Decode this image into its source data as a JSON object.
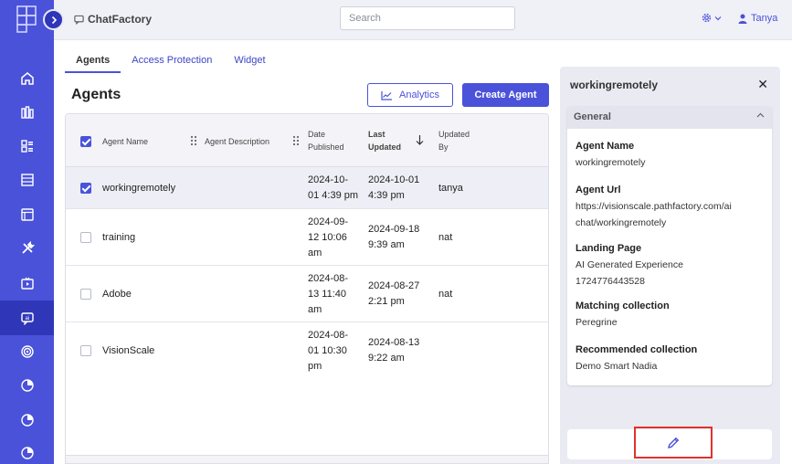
{
  "app": {
    "title": "ChatFactory",
    "search_placeholder": "Search",
    "user_name": "Tanya",
    "accent": "#4a52d9"
  },
  "sidebar": {
    "items": [
      {
        "icon": "home-icon"
      },
      {
        "icon": "library-icon"
      },
      {
        "icon": "grid-icon"
      },
      {
        "icon": "table-icon"
      },
      {
        "icon": "window-icon"
      },
      {
        "icon": "tools-icon"
      },
      {
        "icon": "video-icon"
      },
      {
        "icon": "chat-icon",
        "active": true
      },
      {
        "icon": "target-icon"
      },
      {
        "icon": "pie-icon"
      },
      {
        "icon": "pie-icon"
      },
      {
        "icon": "pie-icon"
      }
    ]
  },
  "tabs": [
    {
      "label": "Agents",
      "active": true
    },
    {
      "label": "Access Protection"
    },
    {
      "label": "Widget"
    }
  ],
  "page": {
    "title": "Agents",
    "analytics_label": "Analytics",
    "create_label": "Create Agent"
  },
  "table": {
    "headers": {
      "name": "Agent Name",
      "description": "Agent Description",
      "date_published_1": "Date",
      "date_published_2": "Published",
      "last_updated_1": "Last",
      "last_updated_2": "Updated",
      "updated_by_1": "Updated",
      "updated_by_2": "By"
    },
    "rows": [
      {
        "name": "workingremotely",
        "published_1": "2024-10-",
        "published_2": "01 4:39 pm",
        "published_3": "",
        "updated_1": "2024-10-01",
        "updated_2": "4:39 pm",
        "by": "tanya",
        "checked": true
      },
      {
        "name": "training",
        "published_1": "2024-09-",
        "published_2": "12 10:06",
        "published_3": "am",
        "updated_1": "2024-09-18",
        "updated_2": "9:39 am",
        "by": "nat",
        "checked": false
      },
      {
        "name": "Adobe",
        "published_1": "2024-08-",
        "published_2": "13 11:40",
        "published_3": "am",
        "updated_1": "2024-08-27",
        "updated_2": "2:21 pm",
        "by": "nat",
        "checked": false
      },
      {
        "name": "VisionScale",
        "published_1": "2024-08-",
        "published_2": "01 10:30",
        "published_3": "pm",
        "updated_1": "2024-08-13",
        "updated_2": "9:22 am",
        "by": "",
        "checked": false
      }
    ]
  },
  "panel": {
    "title": "workingremotely",
    "section": "General",
    "fields": [
      {
        "label": "Agent Name",
        "value_1": "workingremotely",
        "value_2": ""
      },
      {
        "label": "Agent Url",
        "value_1": "https://visionscale.pathfactory.com/ai",
        "value_2": "chat/workingremotely"
      },
      {
        "label": "Landing Page",
        "value_1": "AI Generated Experience",
        "value_2": "1724776443528"
      },
      {
        "label": "Matching collection",
        "value_1": "Peregrine",
        "value_2": ""
      },
      {
        "label": "Recommended collection",
        "value_1": "Demo Smart Nadia",
        "value_2": ""
      }
    ]
  }
}
